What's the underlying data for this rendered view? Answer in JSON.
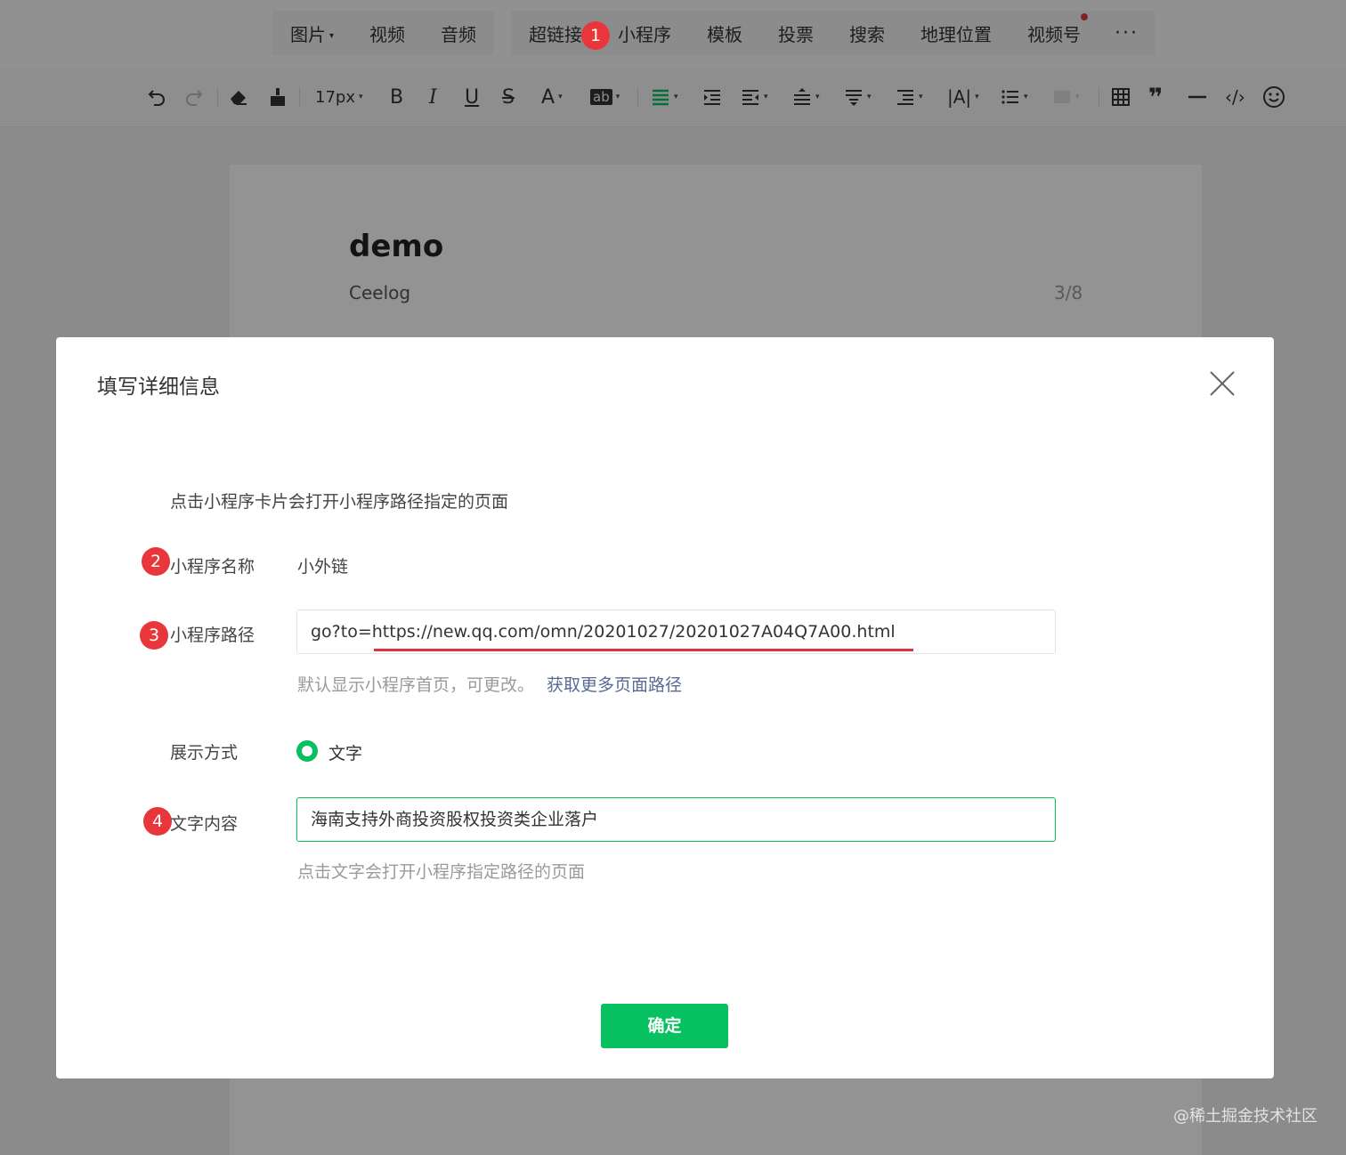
{
  "insert_toolbar": {
    "group1": [
      {
        "label": "图片",
        "has_dropdown": true
      },
      {
        "label": "视频"
      },
      {
        "label": "音频"
      }
    ],
    "group2": [
      {
        "label": "超链接"
      },
      {
        "label": "小程序"
      },
      {
        "label": "模板"
      },
      {
        "label": "投票"
      },
      {
        "label": "搜索"
      },
      {
        "label": "地理位置"
      },
      {
        "label": "视频号",
        "has_notification_dot": true
      }
    ],
    "more": "···"
  },
  "format_toolbar": {
    "font_size": "17px",
    "icons": [
      "undo-icon",
      "redo-icon",
      "eraser-icon",
      "format-painter-icon",
      "font-size-select",
      "bold-icon",
      "italic-icon",
      "underline-icon",
      "strikethrough-icon",
      "font-color-icon",
      "highlight-icon",
      "align-left-icon",
      "indent-icon",
      "outdent-icon",
      "line-height-icon",
      "paragraph-spacing-icon",
      "first-line-indent-icon",
      "letter-spacing-icon",
      "list-icon",
      "image-layout-icon",
      "table-icon",
      "quote-icon",
      "divider-icon",
      "code-icon",
      "emoji-icon"
    ],
    "bold": "B",
    "italic": "I",
    "underline": "U",
    "strike": "S",
    "font_color": "A",
    "highlight": "ab",
    "letter_spacing": "|A|",
    "quote": "❞",
    "code": "‹/›"
  },
  "document": {
    "title": "demo",
    "author": "Ceelog",
    "author_count": "3/8"
  },
  "dialog": {
    "title": "填写详细信息",
    "description": "点击小程序卡片会打开小程序路径指定的页面",
    "name_label": "小程序名称",
    "name_value": "小外链",
    "path_label": "小程序路径",
    "path_value": "go?to=https://new.qq.com/omn/20201027/20201027A04Q7A00.html",
    "path_hint": "默认显示小程序首页，可更改。",
    "path_hint_link": "获取更多页面路径",
    "display_label": "展示方式",
    "display_option": "文字",
    "display_selected": true,
    "text_label": "文字内容",
    "text_value": "海南支持外商投资股权投资类企业落户",
    "text_hint": "点击文字会打开小程序指定路径的页面",
    "confirm": "确定"
  },
  "annotations": {
    "badge1": "1",
    "badge2": "2",
    "badge3": "3",
    "badge4": "4"
  },
  "colors": {
    "accent": "#07c160",
    "badge": "#e8363a",
    "link": "#576b95",
    "underline": "#d9363e"
  },
  "watermark": "@稀土掘金技术社区"
}
